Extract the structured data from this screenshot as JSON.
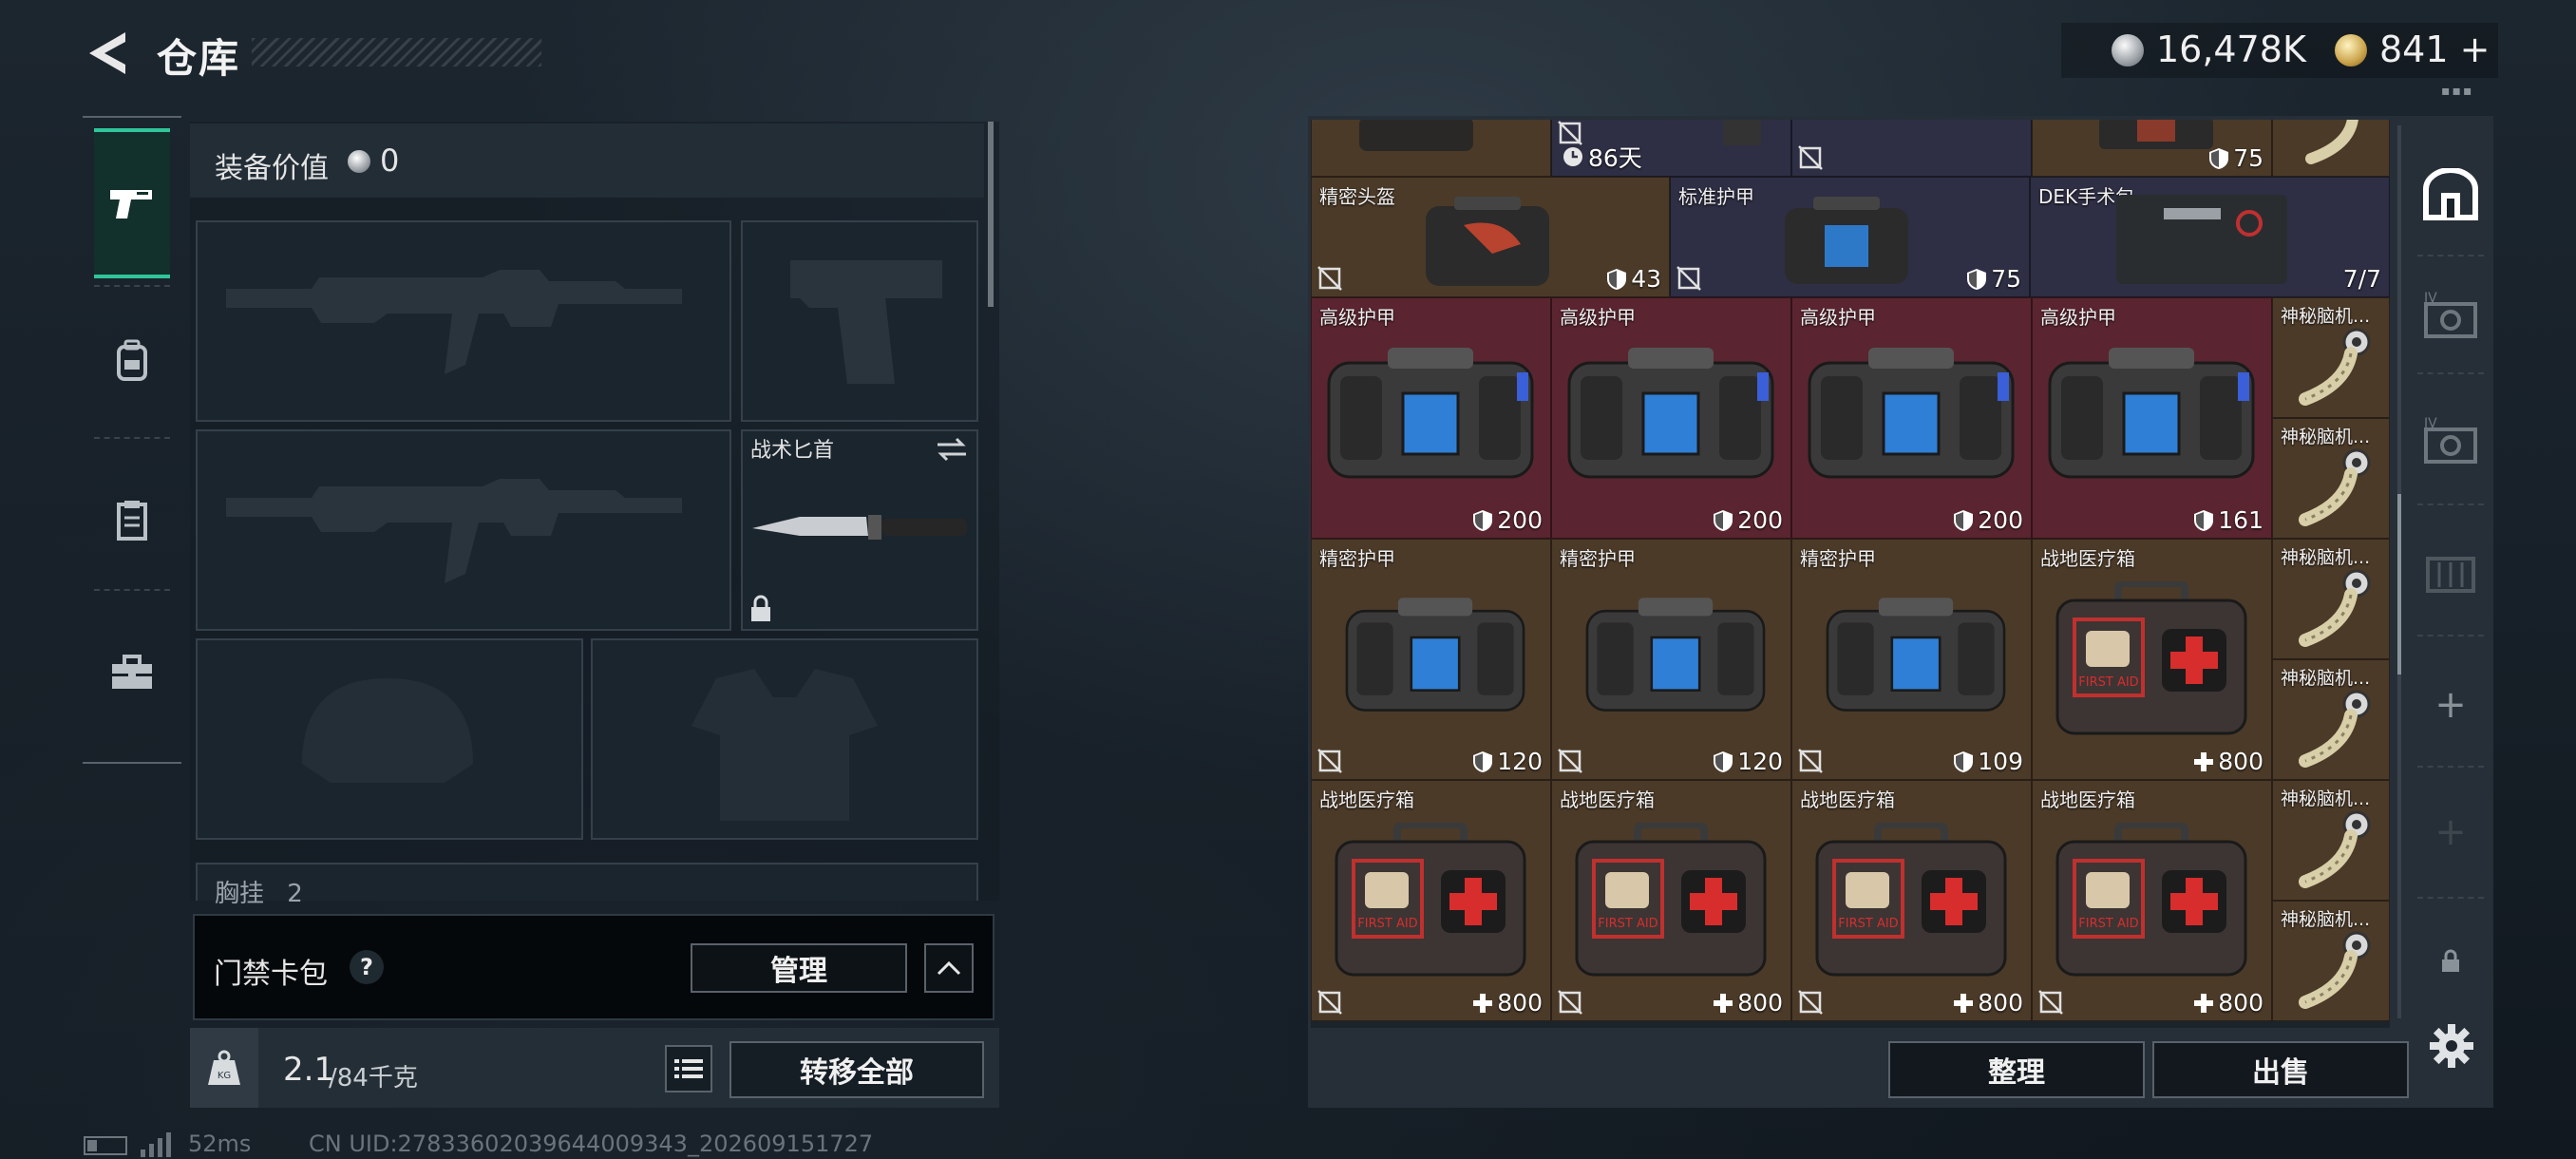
{
  "header": {
    "title": "仓库",
    "silver_value": "16,478K",
    "gold_value": "841",
    "gold_add": "+",
    "menu_dots": "▪▪▪"
  },
  "loadout": {
    "equip_value_label": "装备价值",
    "equip_value": "0",
    "melee_label": "战术匕首",
    "chest_label": "胸挂",
    "chest_extra": "2"
  },
  "keycard": {
    "label": "门禁卡包",
    "help": "?",
    "manage": "管理"
  },
  "capacity": {
    "weight": "2.1",
    "weight_max": "/84千克",
    "weight_icon_text": "KG",
    "transfer_all": "转移全部"
  },
  "status": {
    "ping": "52ms",
    "uid": "CN UID:27833602039644009343_202609151727"
  },
  "stash": {
    "top_row": [
      {
        "value": "86天"
      },
      {
        "value": "75"
      }
    ],
    "row1": [
      {
        "label": "精密头盔",
        "value": "43"
      },
      {
        "label": "标准护甲",
        "value": "75"
      },
      {
        "label": "DEK手术包",
        "value": "7/7"
      }
    ],
    "row2": [
      {
        "label": "高级护甲",
        "value": "200"
      },
      {
        "label": "高级护甲",
        "value": "200"
      },
      {
        "label": "高级护甲",
        "value": "200"
      },
      {
        "label": "高级护甲",
        "value": "161"
      }
    ],
    "row3": [
      {
        "label": "精密护甲",
        "value": "120"
      },
      {
        "label": "精密护甲",
        "value": "120"
      },
      {
        "label": "精密护甲",
        "value": "109"
      },
      {
        "label": "战地医疗箱",
        "value": "800"
      }
    ],
    "row4": [
      {
        "label": "战地医疗箱",
        "value": "800"
      },
      {
        "label": "战地医疗箱",
        "value": "800"
      },
      {
        "label": "战地医疗箱",
        "value": "800"
      },
      {
        "label": "战地医疗箱",
        "value": "800"
      }
    ],
    "side_items": [
      {
        "label": "神秘脑机..."
      },
      {
        "label": "神秘脑机..."
      },
      {
        "label": "神秘脑机..."
      },
      {
        "label": "神秘脑机..."
      },
      {
        "label": "神秘脑机..."
      },
      {
        "label": "神秘脑机..."
      }
    ]
  },
  "actions": {
    "sort": "整理",
    "sell": "出售"
  },
  "right_nav": {
    "badge_iv_1": "IV",
    "badge_iv_2": "IV",
    "plus": "+"
  },
  "medkit_art": {
    "text": "FIRST AID"
  },
  "colors": {
    "accent_green": "#31c59a",
    "rarity_red": "#5a2530",
    "rarity_gold": "#4b3a28",
    "rarity_purple": "#2e2e44"
  }
}
